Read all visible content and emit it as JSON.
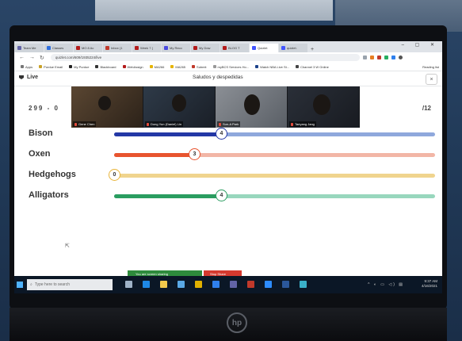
{
  "browser": {
    "tabs": [
      {
        "label": "Team Me",
        "color": "#6264a7"
      },
      {
        "label": "Classes",
        "color": "#2f6fde"
      },
      {
        "label": "MO 8 Ac",
        "color": "#b31b1b"
      },
      {
        "label": "Inbox (1",
        "color": "#c0392b"
      },
      {
        "label": "Week 7 (",
        "color": "#b31b1b"
      },
      {
        "label": "My Reco",
        "color": "#4a4ae0"
      },
      {
        "label": "My Dow",
        "color": "#b31b1b"
      },
      {
        "label": "BLOG T",
        "color": "#b31b1b"
      },
      {
        "label": "Quizlet",
        "color": "#4255ff",
        "active": true
      },
      {
        "label": "quizlet.",
        "color": "#4255ff"
      }
    ],
    "new_tab": "+",
    "window_controls": "– ▢ ✕",
    "url": "quizlet.com/609/1935224/live",
    "bookmarks": [
      {
        "label": "Apps",
        "color": "#777"
      },
      {
        "label": "Purdue Email",
        "color": "#c9a227"
      },
      {
        "label": "My Purdue",
        "color": "#222"
      },
      {
        "label": "Blackboard",
        "color": "#333"
      },
      {
        "label": "WebAssign",
        "color": "#b31b1b"
      },
      {
        "label": "MA266",
        "color": "#e6b400"
      },
      {
        "label": "MA265",
        "color": "#e6b400"
      },
      {
        "label": "Submit",
        "color": "#c0392b"
      },
      {
        "label": "myBCS Services Ho...",
        "color": "#999"
      },
      {
        "label": "Watch NBA Live St...",
        "color": "#1d428a"
      },
      {
        "label": "Channel 3 W Online",
        "color": "#444"
      }
    ],
    "reading_list": "Reading list"
  },
  "app": {
    "mode_label": "Live",
    "title": "Saludos y despedidas",
    "close": "×",
    "score": "299 - 0",
    "question_count": "/12"
  },
  "participants": [
    {
      "name": "Gene Chen"
    },
    {
      "name": "Dong Yun (Daniel) Lin"
    },
    {
      "name": "Sun-A Park"
    },
    {
      "name": "Taeyang Jang"
    }
  ],
  "teams": [
    {
      "name": "Bison",
      "score": "4",
      "progress": 0.333,
      "color": "#2438a6",
      "track": "#8fa8dc"
    },
    {
      "name": "Oxen",
      "score": "3",
      "progress": 0.25,
      "color": "#e8542f",
      "track": "#f2b6a6"
    },
    {
      "name": "Hedgehogs",
      "score": "0",
      "progress": 0.0,
      "color": "#e9b53a",
      "track": "#f0d48e"
    },
    {
      "name": "Alligators",
      "score": "4",
      "progress": 0.333,
      "color": "#2a9d60",
      "track": "#98d7bd"
    }
  ],
  "sharing": {
    "banner": "You are screen sharing",
    "stop": "Stop Share"
  },
  "taskbar": {
    "search_placeholder": "Type here to search",
    "tray_icons": "^ ◐ ▭ ◁) ▤",
    "time": "9:37 AM",
    "date": "4/16/2021",
    "apps": [
      {
        "name": "task-view-icon",
        "color": "#9fb3c8"
      },
      {
        "name": "edge-icon",
        "color": "#1e88e5"
      },
      {
        "name": "file-explorer-icon",
        "color": "#f2c94c"
      },
      {
        "name": "store-icon",
        "color": "#5aa9e6"
      },
      {
        "name": "chrome-icon",
        "color": "#e0b000"
      },
      {
        "name": "app-icon-blue",
        "color": "#2f80ed"
      },
      {
        "name": "app-icon-purple",
        "color": "#6264a7"
      },
      {
        "name": "app-icon-red",
        "color": "#c0392b"
      },
      {
        "name": "zoom-icon",
        "color": "#2d8cff"
      },
      {
        "name": "word-icon",
        "color": "#2b579a"
      },
      {
        "name": "app-icon-teal",
        "color": "#3ab0c8"
      }
    ]
  }
}
